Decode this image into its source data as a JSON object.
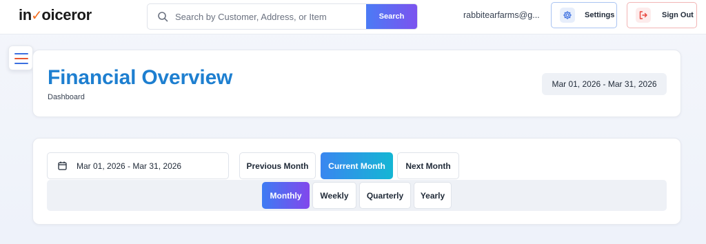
{
  "app": {
    "logo_prefix": "in",
    "logo_check": "✓",
    "logo_suffix": "oiceror"
  },
  "search": {
    "placeholder": "Search by Customer, Address, or Item",
    "value": "",
    "button_label": "Search"
  },
  "user": {
    "email": "rabbitearfarms@g..."
  },
  "header_actions": {
    "settings_label": "Settings",
    "signout_label": "Sign Out"
  },
  "page": {
    "title": "Financial Overview",
    "subtitle": "Dashboard",
    "date_range_badge": "Mar 01, 2026 - Mar 31, 2026"
  },
  "filters": {
    "date_range_value": "Mar 01, 2026 - Mar 31, 2026",
    "period_buttons": [
      {
        "label": "Previous Month",
        "active": false
      },
      {
        "label": "Current Month",
        "active": true
      },
      {
        "label": "Next Month",
        "active": false
      }
    ],
    "granularity_buttons": [
      {
        "label": "Monthly",
        "active": true
      },
      {
        "label": "Weekly",
        "active": false
      },
      {
        "label": "Quarterly",
        "active": false
      },
      {
        "label": "Yearly",
        "active": false
      }
    ]
  },
  "icons": {
    "search": "search-icon",
    "settings": "gear-icon",
    "signout": "logout-icon",
    "menu": "hamburger-icon",
    "calendar": "calendar-icon"
  },
  "colors": {
    "brand_title": "#1e7fd0",
    "logo_accent": "#f36f21",
    "search_button_gradient": [
      "#4b7bf5",
      "#7b53ef"
    ],
    "active_period_gradient": [
      "#3a86f0",
      "#14b6d4"
    ],
    "active_granularity_gradient": [
      "#3d7cf3",
      "#8247ec"
    ],
    "settings_border": "#a9c3f2",
    "signout_border": "#f2b4b4",
    "menu_lines": [
      "#3b6fe0",
      "#e8552f",
      "#3b6fe0"
    ]
  }
}
